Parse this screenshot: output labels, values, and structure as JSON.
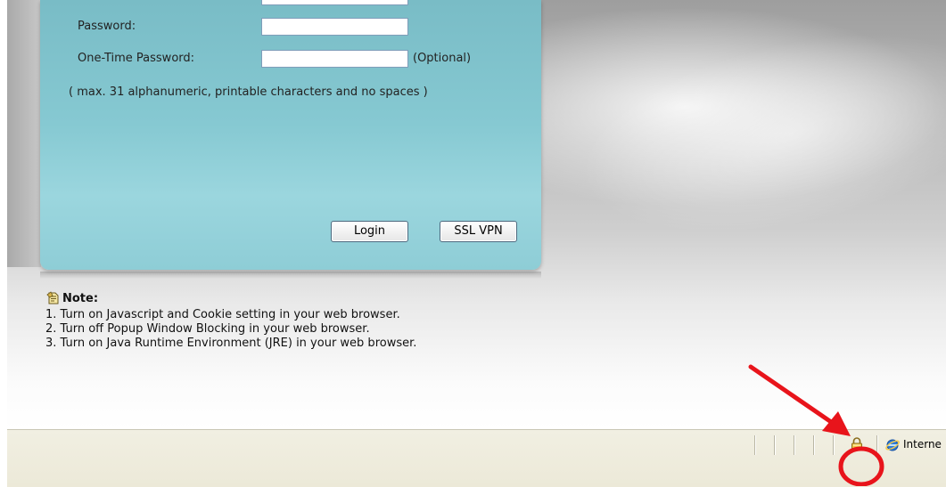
{
  "login_form": {
    "password_label": "Password:",
    "password_value": "",
    "otp_label": "One-Time Password:",
    "otp_value": "",
    "otp_optional": "(Optional)",
    "hint": "( max. 31 alphanumeric, printable characters and no spaces )",
    "login_button": "Login",
    "sslvpn_button": "SSL VPN"
  },
  "note": {
    "title": "Note:",
    "items": [
      "1. Turn on Javascript and Cookie setting in your web browser.",
      "2. Turn off Popup Window Blocking in your web browser.",
      "3. Turn on Java Runtime Environment (JRE) in your web browser."
    ]
  },
  "statusbar": {
    "security_icon": "padlock-icon",
    "zone_icon": "internet-explorer-icon",
    "zone_text": "Interne"
  },
  "annotation": {
    "arrow_color": "#e8141b",
    "circle_color": "#e8141b"
  }
}
